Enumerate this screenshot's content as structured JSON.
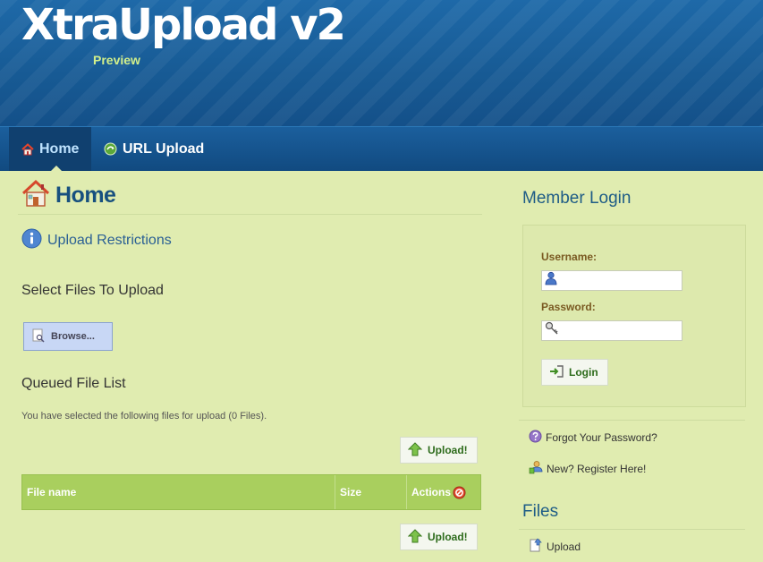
{
  "header": {
    "title": "XtraUpload v2",
    "subtitle": "Preview"
  },
  "nav": [
    {
      "label": "Home",
      "icon": "home-icon",
      "active": true
    },
    {
      "label": "URL Upload",
      "icon": "globe-icon",
      "active": false
    }
  ],
  "main": {
    "page_title": "Home",
    "restrictions_link": "Upload Restrictions",
    "select_heading": "Select Files To Upload",
    "browse_label": "Browse...",
    "queue_heading": "Queued File List",
    "queue_note": "You have selected the following files for upload (0 Files).",
    "upload_label": "Upload!",
    "table_columns": [
      "File name",
      "Size",
      "Actions"
    ]
  },
  "sidebar": {
    "login_heading": "Member Login",
    "username_label": "Username:",
    "username_value": "",
    "password_label": "Password:",
    "password_value": "",
    "login_button": "Login",
    "forgot_link": "Forgot Your Password?",
    "register_link": "New? Register Here!",
    "files_heading": "Files",
    "files_upload_link": "Upload"
  },
  "colors": {
    "header_blue": "#1a5f9c",
    "page_bg": "#e0ecb0",
    "table_head": "#a9cf5e",
    "title_blue": "#17507f",
    "label_brown": "#7a5a22",
    "button_text": "#2d6b1b"
  }
}
